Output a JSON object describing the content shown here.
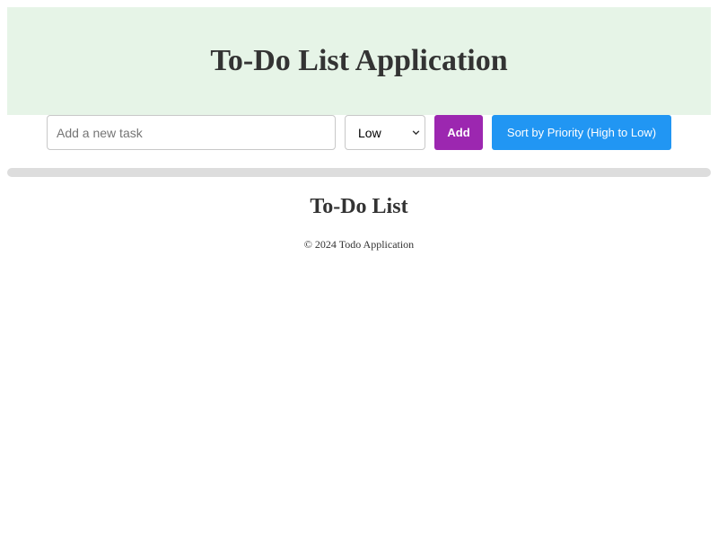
{
  "header": {
    "title": "To-Do List Application"
  },
  "form": {
    "task_placeholder": "Add a new task",
    "task_value": "",
    "priority_selected": "Low",
    "add_label": "Add",
    "sort_label": "Sort by Priority (High to Low)"
  },
  "list": {
    "title": "To-Do List",
    "items": []
  },
  "footer": {
    "text": "© 2024 Todo Application"
  },
  "colors": {
    "header_bg": "#e6f4e7",
    "add_button": "#9c27b0",
    "sort_button": "#2196f3",
    "divider": "#dddddd",
    "text": "#333333"
  },
  "icons": {
    "select_arrow": "chevron-down-icon"
  }
}
